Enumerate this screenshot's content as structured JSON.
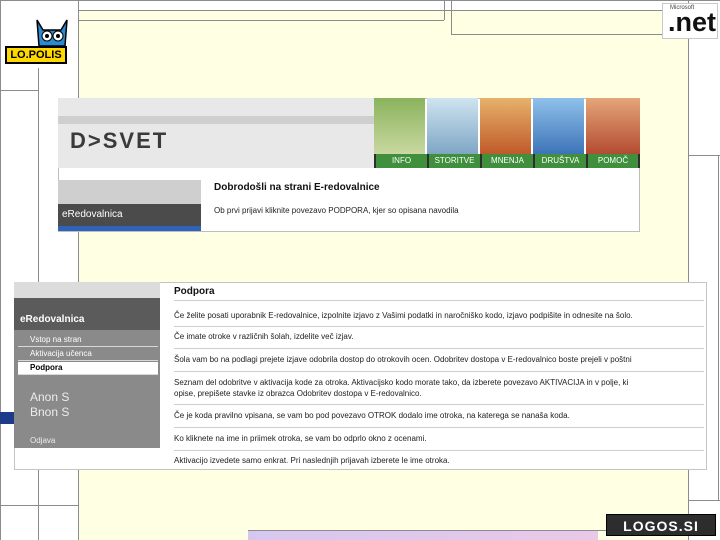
{
  "logos": {
    "lopolis": "LO.POLIS",
    "net_small": "Microsoft",
    "net_big": ".net",
    "logos": "LOGOS.SI"
  },
  "dsvet": {
    "logo": "D>SVET",
    "nav": [
      "INFO",
      "STORITVE",
      "MNENJA",
      "DRUŠTVA",
      "POMOČ"
    ],
    "side_label": "eRedovalnica",
    "welcome_title": "Dobrodošli na strani E-redovalnice",
    "welcome_text": "Ob prvi prijavi kliknite povezavo PODPORA, kjer so opisana navodila"
  },
  "support": {
    "side_label": "eRedovalnica",
    "menu": [
      "Vstop na stran",
      "Aktivacija učenca",
      "Podpora"
    ],
    "menu_lower": [
      "Anon S",
      "Bnon S",
      "Odjava"
    ],
    "title": "Podpora",
    "paragraphs": [
      "Če želite posati uporabnik E-redovalnice, izpolnite izjavo z Vašimi podatki in naročniško kodo, izjavo podpišite in odnesite na šolo.",
      "Če imate otroke v različnih šolah, izdelite več izjav.",
      "Šola vam bo na podlagi prejete izjave odobrila dostop do otrokovih ocen. Odobritev dostopa v E-redovalnico boste prejeli v poštni",
      "Seznam del odobritve v aktivacija kode za otroka. Aktivacijsko kodo morate tako, da izberete povezavo AKTIVACIJA in v polje, ki",
      "opise, prepišete stavke iz obrazca Odobritev dostopa v E-redovalnico.",
      "Če je koda pravilno vpisana, se vam bo pod povezavo OTROK dodalo ime otroka, na katerega se nanaša koda.",
      "Ko kliknete na ime in priimek otroka, se vam bo odprlo okno z ocenami.",
      "Aktivacijo izvedete samo enkrat. Pri naslednjih prijavah izberete le ime otroka."
    ]
  },
  "colors": {
    "nav_green": "#3f8f3c",
    "yellow_bg": "#ffffe3",
    "accent_blue": "#2e63b8"
  }
}
